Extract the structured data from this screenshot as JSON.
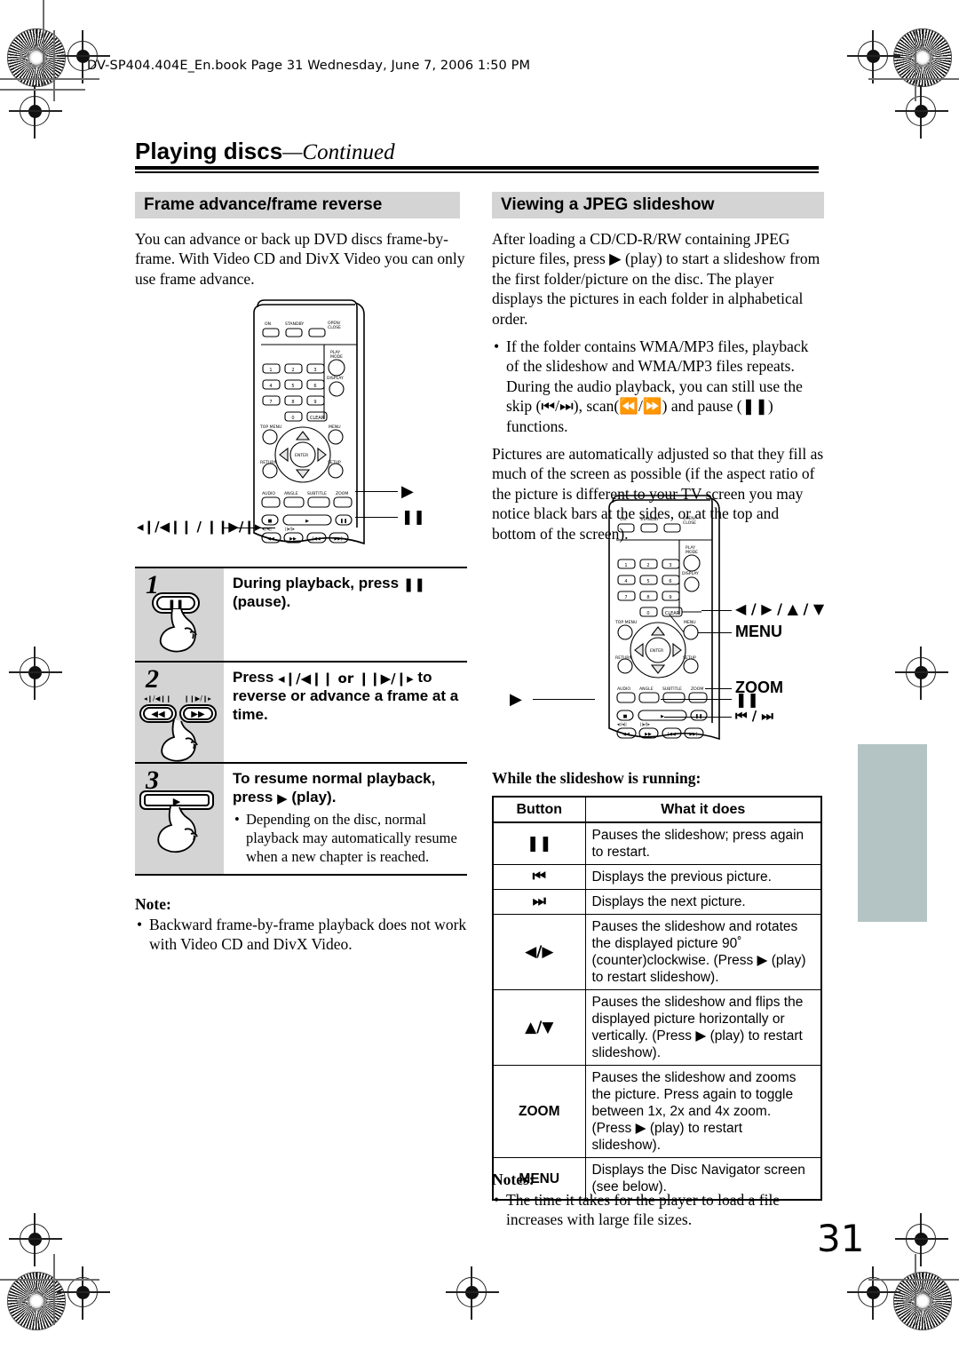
{
  "slug": "DV-SP404.404E_En.book  Page 31  Wednesday, June 7, 2006  1:50 PM",
  "chapter": {
    "title": "Playing discs",
    "continued": "—Continued"
  },
  "page_number": "31",
  "colors": {
    "section_header_bg": "#d4d4d4",
    "step_num_bg": "#d4d4d4",
    "thumb_tab": "#b4c4c4"
  },
  "left": {
    "section_title": "Frame advance/frame reverse",
    "intro": "You can advance or back up DVD discs frame-by-frame. With Video CD and DivX Video you can only use frame advance.",
    "remote_callouts": {
      "play": "▶",
      "pause": "❚❚",
      "frame": "◂❙/◀❙❙ / ❙❙▶/❙▸"
    },
    "steps": [
      {
        "num": "1",
        "heading_pre": "During playback, press ",
        "heading_glyph": "❚❚",
        "heading_post": " (pause).",
        "button_art": "pause-button",
        "bullets": []
      },
      {
        "num": "2",
        "heading_pre": "Press ",
        "heading_glyph": "◂❙/◀❙❙ or ❙❙▶/❙▸",
        "heading_post": " to reverse or advance a frame at a time.",
        "button_art": "scan-buttons",
        "button_labels": [
          "◂❙/◀❙❙",
          "❙❙▶/❙▸"
        ],
        "bullets": []
      },
      {
        "num": "3",
        "heading_pre": "To resume normal playback, press ",
        "heading_glyph": "▶",
        "heading_post": " (play).",
        "button_art": "play-bar",
        "bullets": [
          "Depending on the disc, normal playback may automatically resume when a new chapter is reached."
        ]
      }
    ],
    "note_heading": "Note:",
    "notes": [
      "Backward frame-by-frame playback does not work with Video CD and DivX Video."
    ]
  },
  "right": {
    "section_title": "Viewing a JPEG slideshow",
    "intro": "After loading a CD/CD-R/RW containing JPEG picture files, press ▶ (play) to start a slideshow from the first folder/picture on the disc. The player displays the pictures in each folder in alphabetical order.",
    "intro_bullets": [
      "If the folder contains WMA/MP3 files, playback of the slideshow and WMA/MP3 files repeats. During the audio playback, you can still use the skip (⏮/⏭), scan(⏪/⏩) and pause (❚❚) functions."
    ],
    "para2": "Pictures are automatically adjusted so that they fill as much of the screen as possible (if the aspect ratio of the picture is different to your TV screen you may notice black bars at the sides, or at the top and bottom of the screen).",
    "remote_callouts": {
      "arrows": "◀ / ▶ / ▲ / ▼",
      "menu": "MENU",
      "zoom": "ZOOM",
      "pause": "❚❚",
      "skip": "⏮ / ⏭",
      "play": "▶"
    },
    "table_intro": "While the slideshow is running:",
    "table": {
      "headers": [
        "Button",
        "What it does"
      ],
      "rows": [
        {
          "button": "❚❚",
          "button_kind": "glyph",
          "what": "Pauses the slideshow; press again to restart."
        },
        {
          "button": "⏮",
          "button_kind": "glyph",
          "what": "Displays the previous picture."
        },
        {
          "button": "⏭",
          "button_kind": "glyph",
          "what": "Displays the next picture."
        },
        {
          "button": "◀/▶",
          "button_kind": "glyph",
          "what": "Pauses the slideshow and rotates the displayed picture 90˚ (counter)clockwise. (Press ▶ (play) to restart slideshow)."
        },
        {
          "button": "▲/▼",
          "button_kind": "glyph",
          "what": "Pauses the slideshow and flips the displayed picture horizontally or vertically. (Press ▶ (play) to restart slideshow)."
        },
        {
          "button": "ZOOM",
          "button_kind": "word",
          "what": "Pauses the slideshow and zooms the picture. Press again to toggle between 1x, 2x and 4x zoom. (Press ▶ (play) to restart slideshow)."
        },
        {
          "button": "MENU",
          "button_kind": "word",
          "what": "Displays the Disc Navigator screen (see below)."
        }
      ]
    },
    "notes_heading": "Notes:",
    "notes": [
      "The time it takes for the player to load a file increases with large file sizes."
    ]
  },
  "remote_keys": {
    "on": "ON",
    "standby": "STANDBY",
    "open_close": "OPEN/ CLOSE",
    "play_mode": "PLAY MODE",
    "display": "DISPLAY",
    "digits": [
      "1",
      "2",
      "3",
      "4",
      "5",
      "6",
      "7",
      "8",
      "9",
      "0"
    ],
    "clear": "CLEAR",
    "top_menu": "TOP MENU",
    "menu": "MENU",
    "return": "RETURN",
    "setup": "SETUP",
    "enter": "ENTER",
    "audio": "AUDIO",
    "angle": "ANGLE",
    "subtitle": "SUBTITLE",
    "zoom": "ZOOM"
  }
}
